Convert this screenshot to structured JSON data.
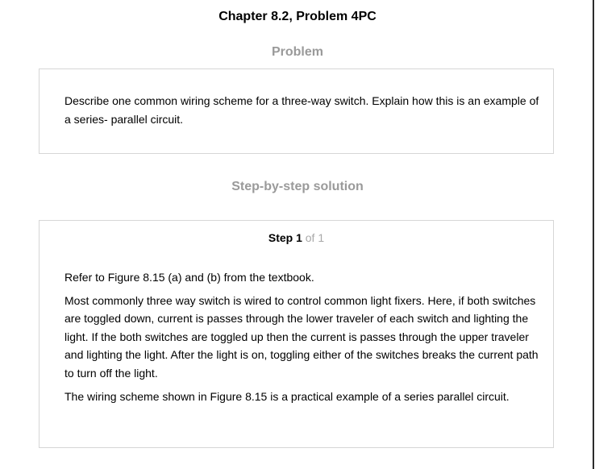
{
  "page": {
    "chapter_title": "Chapter 8.2, Problem 4PC"
  },
  "problem": {
    "heading": "Problem",
    "text": "Describe one common wiring scheme for a three-way switch. Explain how this is an example of a series- parallel circuit."
  },
  "solution": {
    "heading": "Step-by-step solution",
    "step_label": "Step 1",
    "step_of": "of 1",
    "paragraphs": [
      "Refer to Figure 8.15 (a) and (b) from the textbook.",
      "Most commonly three way switch is wired to control common light fixers. Here, if both switches are toggled down, current is passes through the lower traveler of each switch and lighting the light. If the both switches are toggled up then the current is passes through the upper traveler and lighting the light. After the light is on, toggling either of the switches breaks the current path to turn off the light.",
      "The wiring scheme shown in Figure 8.15 is a practical example of a series parallel circuit."
    ]
  }
}
